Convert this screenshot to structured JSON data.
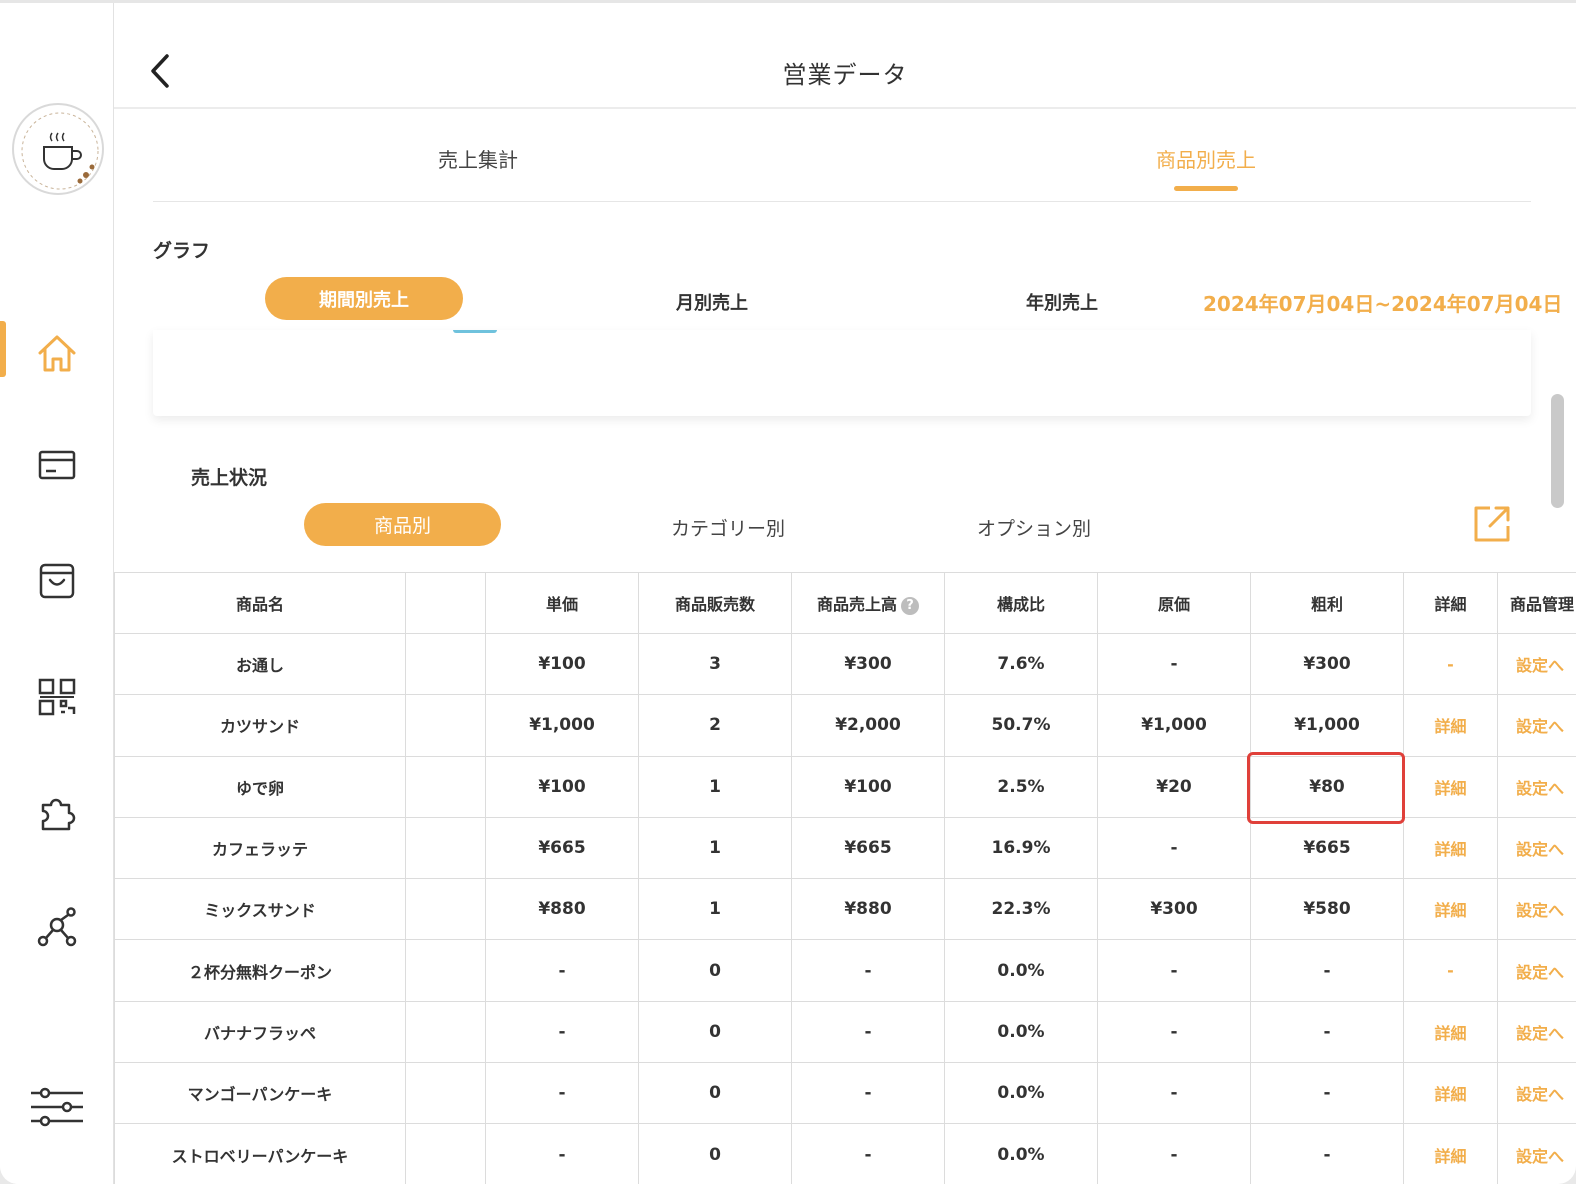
{
  "header": {
    "title": "営業データ"
  },
  "top_tabs": [
    {
      "label": "売上集計",
      "active": false
    },
    {
      "label": "商品別売上",
      "active": true
    }
  ],
  "graph": {
    "title": "グラフ",
    "period_tabs": [
      "期間別売上",
      "月別売上",
      "年別売上"
    ],
    "active_period": "期間別売上",
    "date_range": "2024年07月04日~2024年07月04日"
  },
  "sales": {
    "title": "売上状況",
    "segment_tabs": [
      "商品別",
      "カテゴリー別",
      "オプション別"
    ],
    "active_segment": "商品別"
  },
  "table": {
    "headers": [
      "商品名",
      "単価",
      "商品販売数",
      "商品売上高",
      "構成比",
      "原価",
      "粗利",
      "詳細",
      "商品管理"
    ],
    "rows": [
      [
        "お通し",
        "¥100",
        "3",
        "¥300",
        "7.6%",
        "-",
        "¥300",
        "-",
        "設定へ"
      ],
      [
        "カツサンド",
        "¥1,000",
        "2",
        "¥2,000",
        "50.7%",
        "¥1,000",
        "¥1,000",
        "詳細",
        "設定へ"
      ],
      [
        "ゆで卵",
        "¥100",
        "1",
        "¥100",
        "2.5%",
        "¥20",
        "¥80",
        "詳細",
        "設定へ"
      ],
      [
        "カフェラッテ",
        "¥665",
        "1",
        "¥665",
        "16.9%",
        "-",
        "¥665",
        "詳細",
        "設定へ"
      ],
      [
        "ミックスサンド",
        "¥880",
        "1",
        "¥880",
        "22.3%",
        "¥300",
        "¥580",
        "詳細",
        "設定へ"
      ],
      [
        "２杯分無料クーポン",
        "-",
        "0",
        "-",
        "0.0%",
        "-",
        "-",
        "-",
        "設定へ"
      ],
      [
        "バナナフラッペ",
        "-",
        "0",
        "-",
        "0.0%",
        "-",
        "-",
        "詳細",
        "設定へ"
      ],
      [
        "マンゴーパンケーキ",
        "-",
        "0",
        "-",
        "0.0%",
        "-",
        "-",
        "詳細",
        "設定へ"
      ],
      [
        "ストロベリーパンケーキ",
        "-",
        "0",
        "-",
        "0.0%",
        "-",
        "-",
        "詳細",
        "設定へ"
      ]
    ]
  },
  "colors": {
    "accent": "#f2ae4b",
    "highlight": "#e0403a"
  }
}
